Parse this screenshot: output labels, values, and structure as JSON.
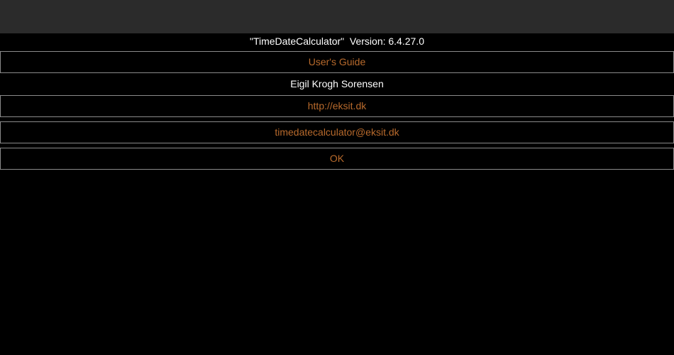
{
  "about": {
    "app_name_version": "\"TimeDateCalculator\"  Version: 6.4.27.0",
    "users_guide_label": "User's Guide",
    "author": "Eigil Krogh Sorensen",
    "website_link": "http://eksit.dk",
    "email_link": "timedatecalculator@eksit.dk",
    "ok_label": "OK"
  },
  "colors": {
    "link": "#b86a2c",
    "text": "#ffffff",
    "background": "#000000",
    "titlebar": "#2b2b2b",
    "border": "#8a8a8a"
  }
}
